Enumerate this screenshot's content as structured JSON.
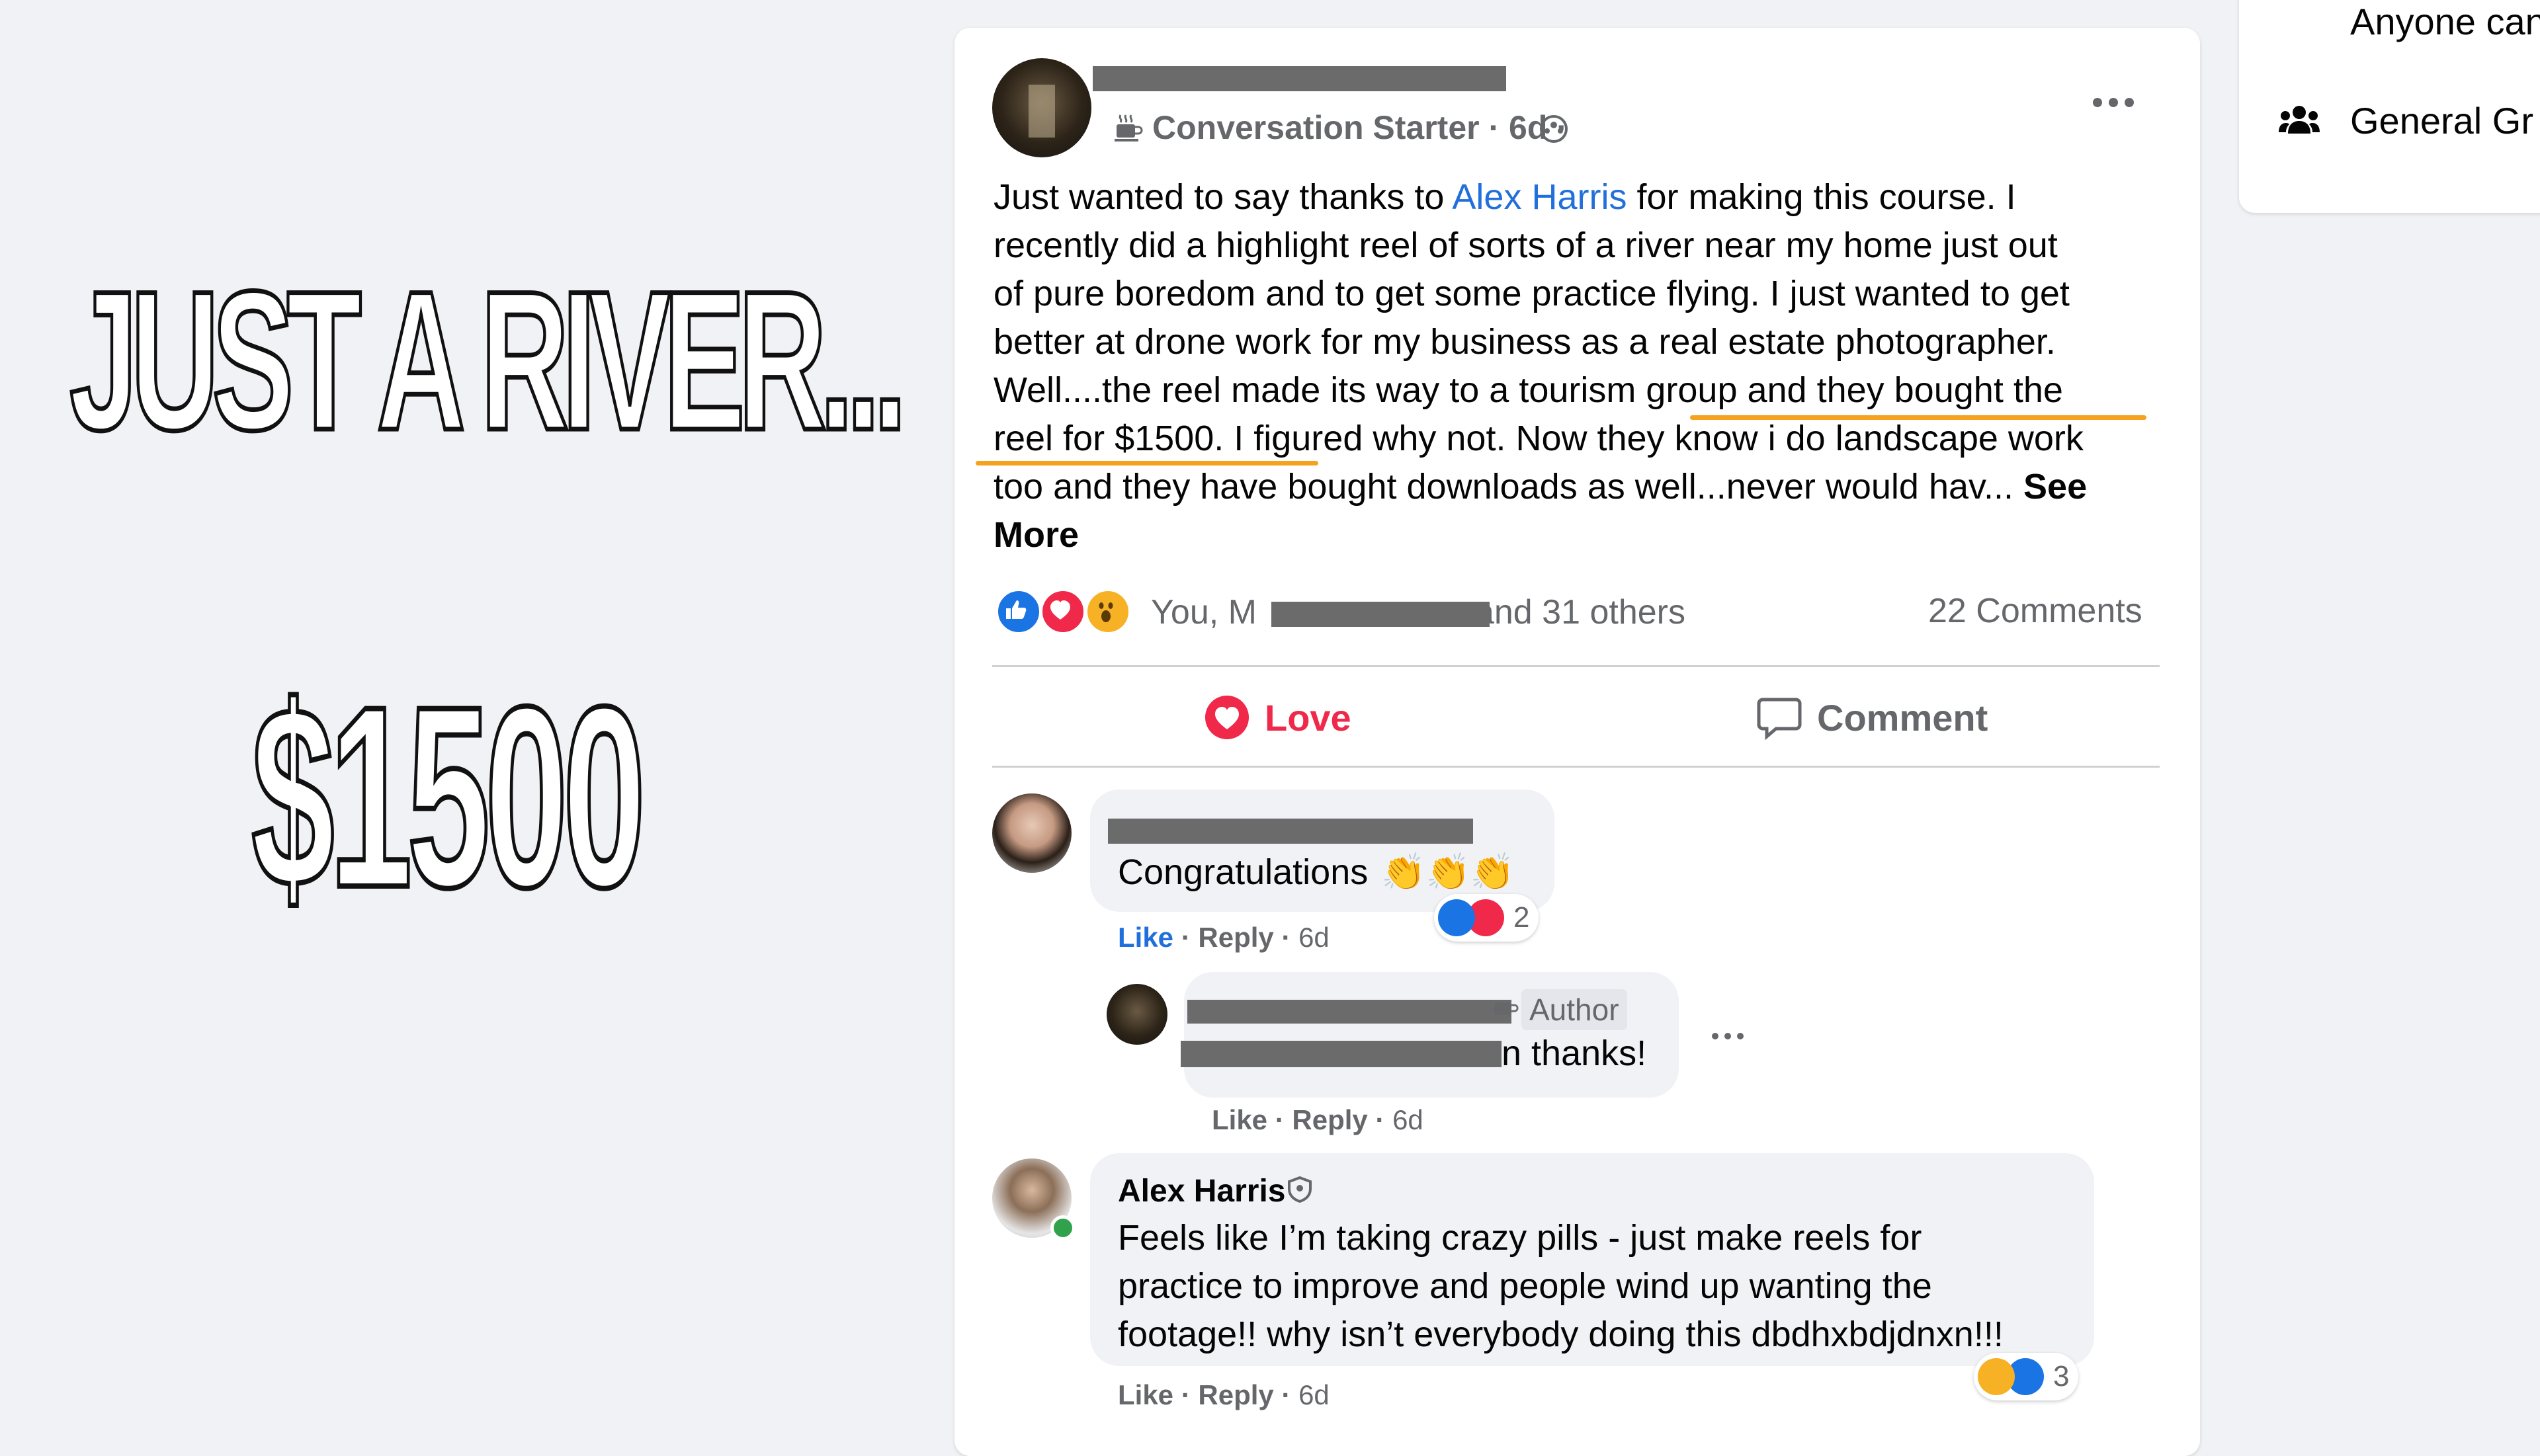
{
  "overlay": {
    "title": "JUST A RIVER...",
    "price": "$1500"
  },
  "right_panel": {
    "line1": "Anyone can",
    "line2": "General Gr"
  },
  "post": {
    "badge": "Conversation Starter",
    "time": "6d",
    "text_lines": [
      "recently did a highlight reel of sorts of a river near my home just out",
      "of pure boredom and to get some practice flying.  I just wanted to get",
      "better at drone work for my business as a real estate photographer.",
      "Well....the reel made its way to a tourism group and they bought the",
      "reel for $1500.  I figured why not.  Now they know i do landscape work",
      "too and they have bought downloads as well...never would hav..."
    ],
    "text_first_pre": "Just wanted to say thanks to ",
    "text_first_link": "Alex Harris",
    "text_first_post": " for making this course.  I",
    "see": "See",
    "more": "More",
    "reactions_text_pre": "You, M",
    "reactions_text_post": "and 31 others",
    "comments_count": "22 Comments",
    "love_label": "Love",
    "comment_label": "Comment"
  },
  "comments": [
    {
      "text": "Congratulations",
      "like": "Like",
      "reply": "Reply",
      "time": "6d",
      "reaction_count": "2"
    },
    {
      "author_badge": "Author",
      "text": "n thanks!",
      "like": "Like",
      "reply": "Reply",
      "time": "6d"
    },
    {
      "name": "Alex Harris",
      "lines": [
        "Feels like I’m taking crazy pills - just make reels for",
        "practice to improve and people wind up wanting the",
        "footage!! why isn’t everybody doing this dbdhxbdjdnxn!!!"
      ],
      "like": "Like",
      "reply": "Reply",
      "time": "6d",
      "reaction_count": "3"
    }
  ],
  "colors": {
    "link": "#216fdb",
    "love": "#f02849",
    "highlight_underline": "#f5a21f"
  }
}
